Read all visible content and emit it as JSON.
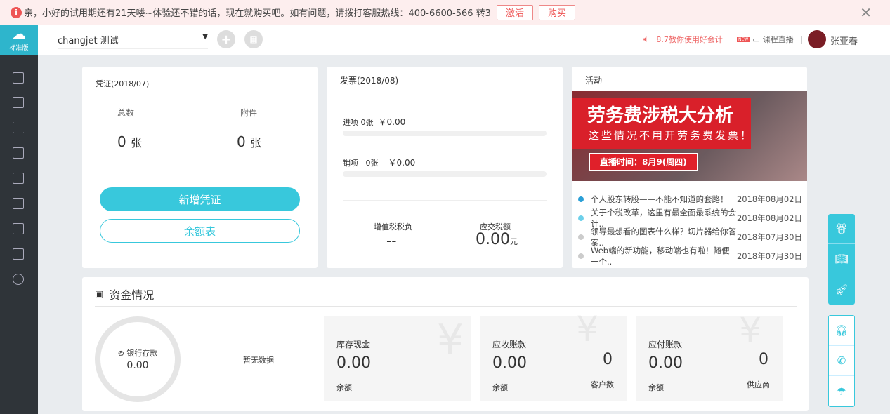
{
  "banner": {
    "text": "亲，小好的试用期还有21天喽~体验还不错的话，现在就购买吧。如有问题，请拨打客服热线：400-6600-566 转3",
    "activate": "激活",
    "buy": "购买"
  },
  "logo": {
    "label": "标准版"
  },
  "header": {
    "account": "changjet 测试",
    "promo": "8.7教你使用好会计",
    "new_badge": "NEW",
    "live": "课程直播",
    "user": "张亚春"
  },
  "voucher": {
    "title": "凭证(2018/07)",
    "total_label": "总数",
    "total": "0",
    "attach_label": "附件",
    "attach": "0",
    "unit": "张",
    "add_btn": "新增凭证",
    "balance_btn": "余额表"
  },
  "invoice": {
    "title": "发票(2018/08)",
    "in_label": "进项",
    "in_count": "0张",
    "in_amount": "￥0.00",
    "out_label": "销项",
    "out_count": "0张",
    "out_amount": "￥0.00",
    "vat_label": "增值税税负",
    "vat": "--",
    "tax_label": "应交税额",
    "tax": "0.00",
    "tax_unit": "元"
  },
  "activity": {
    "title": "活动",
    "banner_title": "劳务费涉税大分析",
    "banner_sub": "这些情况不用开劳务费发票！",
    "banner_time": "直播时间：8月9(周四)",
    "news": [
      {
        "t": "个人股东转股——不能不知道的套路！",
        "d": "2018年08月02日",
        "c": "#2a9fd6"
      },
      {
        "t": "关于个税改革，这里有最全面最系统的会计..",
        "d": "2018年08月02日",
        "c": "#6dd0ea"
      },
      {
        "t": "领导最想看的图表什么样？切片器给你答案..",
        "d": "2018年07月30日",
        "c": "#ccc"
      },
      {
        "t": "Web端的新功能，移动端也有啦！随便一个..",
        "d": "2018年07月30日",
        "c": "#ccc"
      }
    ]
  },
  "funds": {
    "title": "资金情况",
    "bank_label": "银行存款",
    "bank": "0.00",
    "nodata": "暂无数据",
    "tiles": [
      {
        "label": "库存现金",
        "value": "0.00",
        "sub": "余额"
      },
      {
        "label": "应收账款",
        "value": "0.00",
        "sub": "余额",
        "count": "0",
        "count_label": "客户数"
      },
      {
        "label": "应付账款",
        "value": "0.00",
        "sub": "余额",
        "count": "0",
        "count_label": "供应商"
      }
    ]
  }
}
